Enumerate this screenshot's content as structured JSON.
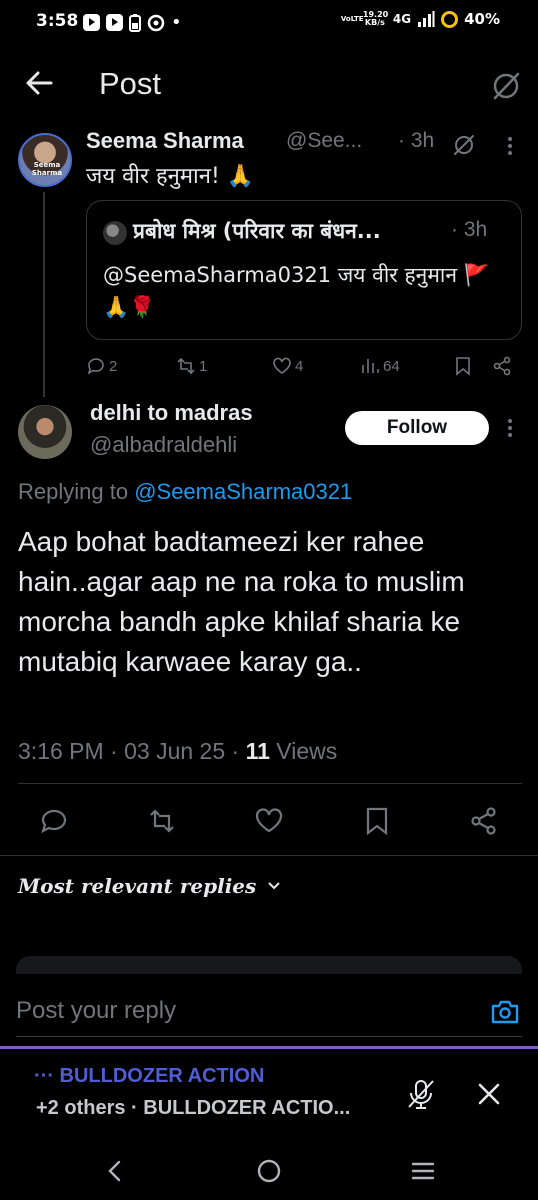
{
  "status_bar": {
    "time": "3:58",
    "network_speed": "19.20\nKB/s",
    "volte": "VoLTE",
    "network": "4G",
    "battery": "40%"
  },
  "header": {
    "title": "Post"
  },
  "parent_post": {
    "avatar_label": "Seema Sharma",
    "name": "Seema Sharma",
    "handle": "@See...",
    "time": "· 3h",
    "text": "जय वीर हनुमान! 🙏",
    "quote": {
      "name": "प्रबोध मिश्र (परिवार का बंधन...",
      "time": "· 3h",
      "text": "@SeemaSharma0321 जय वीर हनुमान 🚩🙏🌹"
    },
    "actions": {
      "replies": "2",
      "reposts": "1",
      "likes": "4",
      "views": "64"
    }
  },
  "main_post": {
    "name": "delhi to madras",
    "handle": "@albadraldehli",
    "follow_label": "Follow",
    "replying_prefix": "Replying to ",
    "replying_to": "@SeemaSharma0321",
    "text": "Aap bohat badtameezi ker rahee hain..agar aap ne na roka to muslim morcha bandh apke khilaf sharia ke mutabiq karwaee karay ga..",
    "timestamp": "3:16 PM · 03 Jun 25 · ",
    "views_count": "11",
    "views_label": " Views"
  },
  "replies_sort": {
    "label": "Most relevant replies"
  },
  "reply_box": {
    "placeholder": "Post your reply"
  },
  "space_bar": {
    "title": "··· BULLDOZER ACTION",
    "subtitle": "+2 others · BULLDOZER ACTIO..."
  },
  "colors": {
    "background": "#000000",
    "text_primary": "#e7e9ea",
    "text_secondary": "#71767b",
    "link": "#1d9bf0",
    "space_accent": "#7b5cd6"
  },
  "icons": [
    "back-arrow-icon",
    "grok-icon",
    "more-vertical-icon",
    "reply-icon",
    "repost-icon",
    "like-icon",
    "views-icon",
    "bookmark-icon",
    "share-icon",
    "chevron-down-icon",
    "camera-icon",
    "mic-off-icon",
    "close-icon",
    "nav-back-icon",
    "nav-home-icon",
    "nav-recents-icon"
  ]
}
